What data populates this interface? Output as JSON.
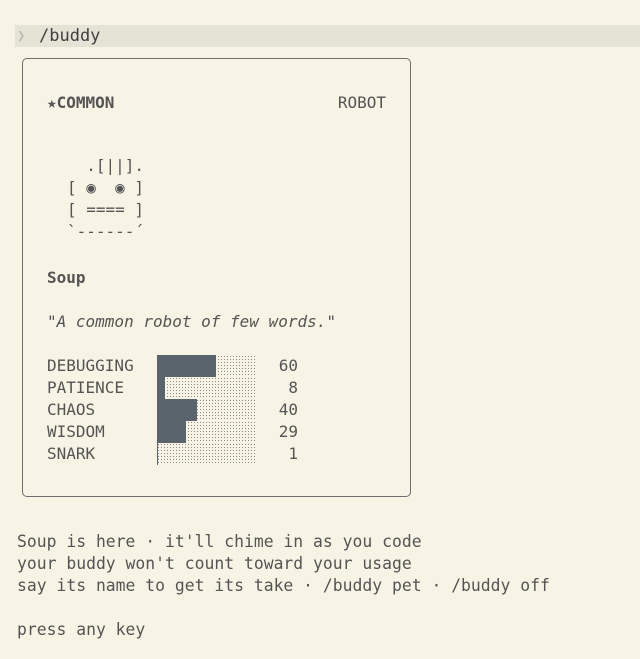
{
  "prompt": {
    "chevron": "❯",
    "command": "/buddy"
  },
  "card": {
    "rarity_star": "★",
    "rarity": "COMMON",
    "species": "ROBOT",
    "ascii_art": "  .[||].\n[ ◉  ◉ ]\n[ ==== ]\n`------´",
    "name": "Soup",
    "description": "\"A common robot of few words.\"",
    "stats": [
      {
        "label": "DEBUGGING",
        "value": 60
      },
      {
        "label": "PATIENCE",
        "value": 8
      },
      {
        "label": "CHAOS",
        "value": 40
      },
      {
        "label": "WISDOM",
        "value": 29
      },
      {
        "label": "SNARK",
        "value": 1
      }
    ]
  },
  "messages": {
    "line1": "Soup is here · it'll chime in as you code",
    "line2": "your buddy won't count toward your usage",
    "line3": "say its name to get its take · /buddy pet · /buddy off",
    "press_key": "press any key"
  }
}
